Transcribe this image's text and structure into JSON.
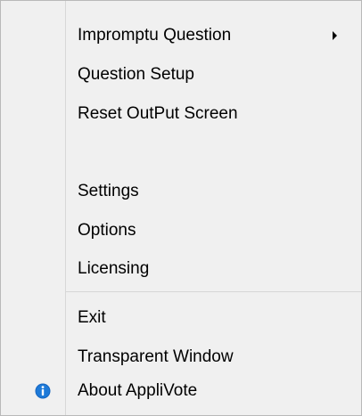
{
  "menu": {
    "items": [
      {
        "label": "Impromptu Question",
        "submenu": true
      },
      {
        "label": "Question Setup"
      },
      {
        "label": "Reset OutPut Screen"
      },
      {
        "label": ""
      },
      {
        "label": "Settings"
      },
      {
        "label": "Options"
      },
      {
        "label": "Licensing"
      },
      {
        "label": "Exit"
      },
      {
        "label": "Transparent Window"
      },
      {
        "label": "About AppliVote",
        "icon": "info-icon"
      }
    ]
  },
  "colors": {
    "background": "#f0f0f0",
    "border": "#b9b9b9",
    "separator": "#d7d7d7",
    "info_icon": "#1565c0"
  },
  "icons": {
    "submenu_indicator": "chevron-right-icon",
    "about": "info-icon"
  }
}
